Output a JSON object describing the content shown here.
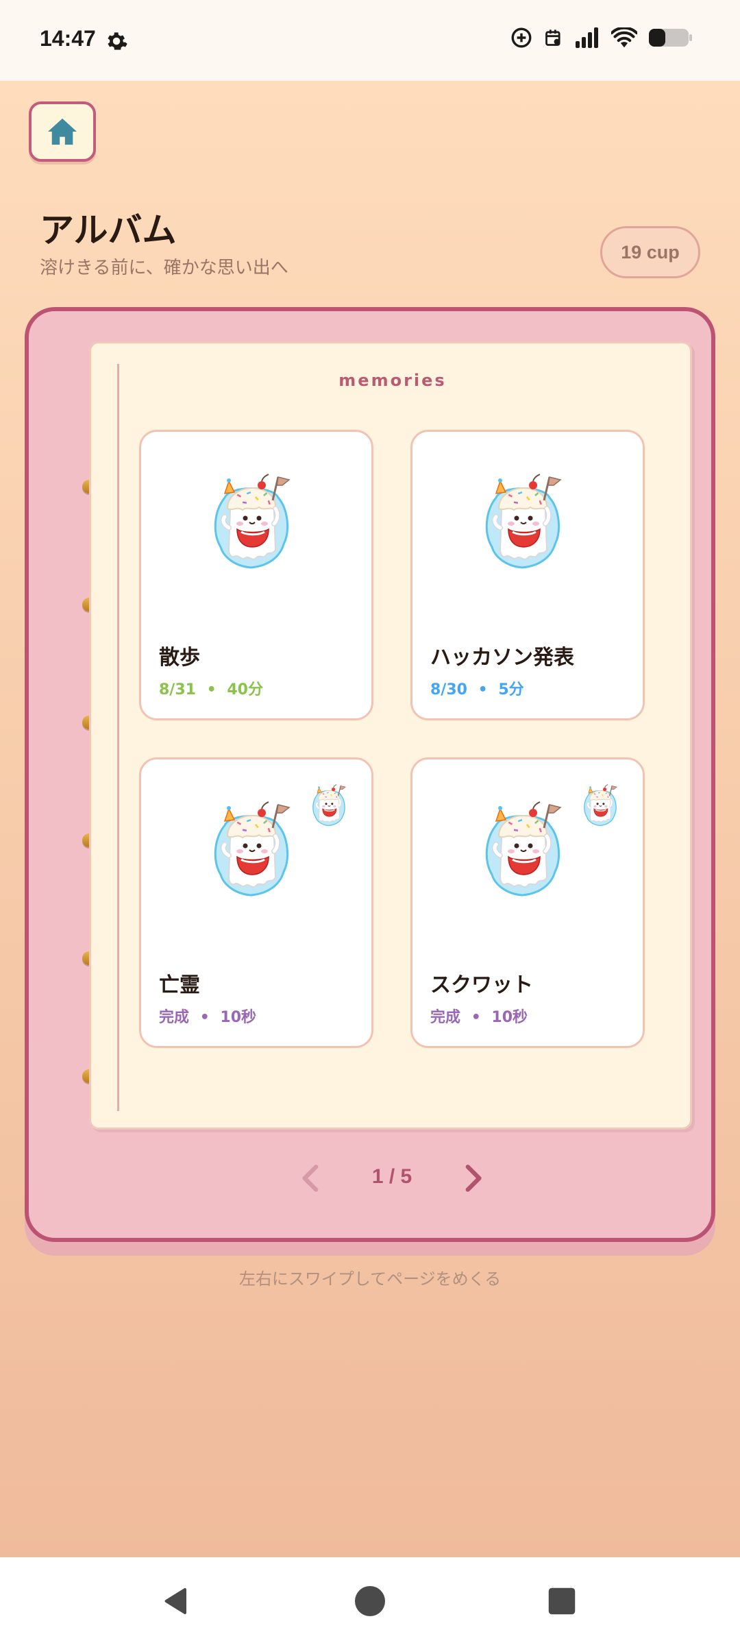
{
  "status_bar": {
    "time": "14:47",
    "icons": [
      "gear-icon",
      "data-saver-icon",
      "calendar-icon",
      "signal-icon",
      "wifi-icon",
      "battery-icon"
    ]
  },
  "header": {
    "home_icon": "home-icon",
    "title": "アルバム",
    "subtitle": "溶けきる前に、確かな思い出へ",
    "cup_count": "19 cup"
  },
  "album": {
    "page_label": "memories",
    "cards": [
      {
        "name": "散歩",
        "date": "8/31",
        "sep": "•",
        "duration": "40分",
        "meta_color": "#8bc34a",
        "has_mini": false
      },
      {
        "name": "ハッカソン発表",
        "date": "8/30",
        "sep": "•",
        "duration": "5分",
        "meta_color": "#42a5f5",
        "has_mini": false
      },
      {
        "name": "亡霊",
        "date": "完成",
        "sep": "•",
        "duration": "10秒",
        "meta_color": "#9a67b4",
        "has_mini": true
      },
      {
        "name": "スクワット",
        "date": "完成",
        "sep": "•",
        "duration": "10秒",
        "meta_color": "#9a67b4",
        "has_mini": true
      }
    ],
    "pager": {
      "text": "1 / 5",
      "prev_icon": "chevron-left-icon",
      "next_icon": "chevron-right-icon"
    }
  },
  "hint": "左右にスワイプしてページをめくる",
  "nav_bar": {
    "back": "back-icon",
    "home": "home-circle-icon",
    "recents": "recents-icon"
  },
  "colors": {
    "accent": "#bc5373",
    "book": "#f2bfc7",
    "page": "#fef4df",
    "ring": "#d69a33"
  }
}
